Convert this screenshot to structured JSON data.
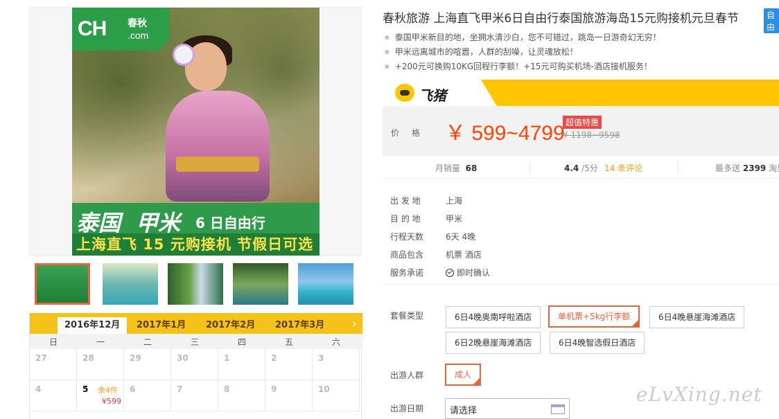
{
  "gallery": {
    "logo": {
      "brand": "CH",
      "cn": "春秋",
      "sub": ".com"
    },
    "banner": {
      "dest1": "泰国",
      "dest2": "甲米",
      "trip": "6 日自由行",
      "slogan": "上海直飞 15 元购接机 节假日可选"
    },
    "thumbnails": [
      {
        "name": "thai-woman",
        "active": true
      },
      {
        "name": "lagoon"
      },
      {
        "name": "waterfall"
      },
      {
        "name": "long-tail-boat"
      },
      {
        "name": "island"
      }
    ]
  },
  "calendar": {
    "months": [
      "2016年12月",
      "2017年1月",
      "2017年2月",
      "2017年3月"
    ],
    "next_icon": "›",
    "weekdays": [
      "日",
      "一",
      "二",
      "三",
      "四",
      "五",
      "六"
    ],
    "rows": [
      [
        {
          "day": "27"
        },
        {
          "day": "28"
        },
        {
          "day": "29"
        },
        {
          "day": "30"
        },
        {
          "day": "1"
        },
        {
          "day": "2"
        },
        {
          "day": "3"
        }
      ],
      [
        {
          "day": "4"
        },
        {
          "day": "5",
          "stock": "余4件",
          "price": "¥599",
          "available": true
        },
        {
          "day": "6"
        },
        {
          "day": "7"
        },
        {
          "day": "8"
        },
        {
          "day": "9"
        },
        {
          "day": "10"
        }
      ]
    ]
  },
  "product": {
    "title": "春秋旅游 上海直飞甲米6日自由行泰国旅游海岛15元购接机元旦春节",
    "title_tag": "自由",
    "features": [
      "泰国甲米新目的地，坐拥水清沙白，您不可错过，跳岛一日游奇幻无穷！",
      "甲米远离城市的喧嚣，人群的刮噪，让灵魂放松！",
      "+200元可换购10KG回程行李额！+15元可购买机场-酒店接机服务！"
    ]
  },
  "fliggy": {
    "name": "飞猪"
  },
  "price": {
    "label": "价格",
    "value": "￥ 599~4799",
    "promo": "超值特惠",
    "original": "¥ 1198~9598"
  },
  "stats": {
    "monthly_label": "月销量",
    "monthly_value": "68",
    "rating": "4.4",
    "rating_suffix": "/5分",
    "reviews": "14 条评论",
    "points_prefix": "最多送",
    "points_value": "2399",
    "points_suffix": "淘里"
  },
  "info": {
    "departure_label": "出 发 地",
    "departure": "上海",
    "destination_label": "目 的 地",
    "destination": "甲米",
    "duration_label": "行程天数",
    "duration": "6天 4晚",
    "includes_label": "商品包含",
    "includes": "机票  酒店",
    "service_label": "服务承诺",
    "service": "即时确认"
  },
  "options": {
    "package_label": "套餐类型",
    "packages": [
      "6日4晚奥南呼啦酒店",
      "单机票+5kg行李额",
      "6日4晚悬崖海滩酒店",
      "6日2晚悬崖海滩酒店",
      "6日4晚智选假日酒店"
    ],
    "selected_package": 1,
    "group_label": "出游人群",
    "group": "成人",
    "date_label": "出游日期",
    "date_placeholder": "请选择"
  },
  "watermark": "eLvXing.net"
}
